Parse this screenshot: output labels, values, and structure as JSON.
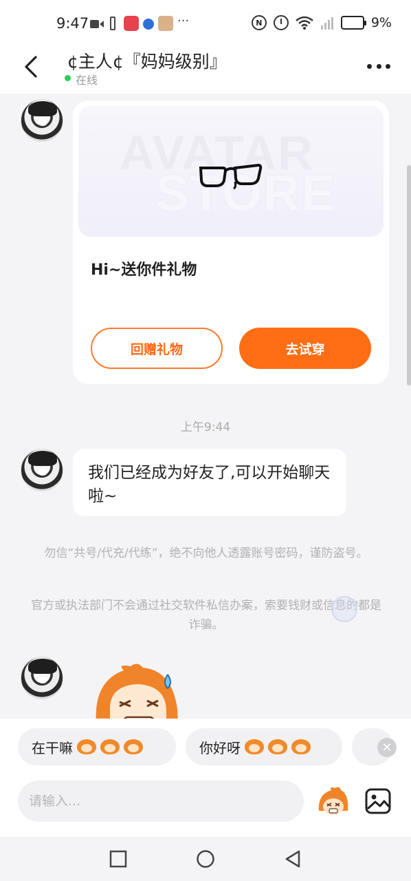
{
  "status_bar": {
    "time": "9:47",
    "more": "···",
    "circle_badge": "N",
    "battery_percent": "9%"
  },
  "header": {
    "title": "¢主人¢『妈妈级别』",
    "status": "在线"
  },
  "gift_card": {
    "banner_line1": "AVATAR",
    "banner_line2": "STORE",
    "message": "Hi~送你件礼物",
    "return_gift_label": "回赠礼物",
    "try_on_label": "去试穿"
  },
  "timestamp": "上午9:44",
  "friend_message": "我们已经成为好友了,可以开始聊天啦~",
  "notices": [
    "勿信“共号/代充/代练”，绝不向他人透露账号密码，谨防盗号。",
    "官方或执法部门不会通过社交软件私信办案，索要钱财或信息的都是诈骗。"
  ],
  "quick_replies": [
    {
      "text": "在干嘛"
    },
    {
      "text": "你好呀"
    },
    {
      "text": ""
    }
  ],
  "input": {
    "placeholder": "请输入..."
  },
  "colors": {
    "accent": "#ff6d14",
    "online": "#2ecc5a",
    "background": "#f4f4f6"
  }
}
